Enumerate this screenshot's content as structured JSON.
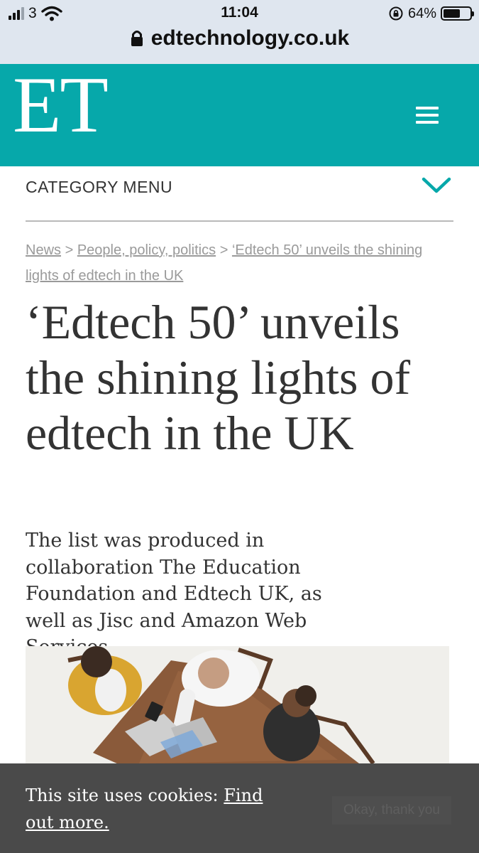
{
  "status_bar": {
    "carrier": "3",
    "time": "11:04",
    "battery_percent_label": "64%",
    "battery_level": 0.64,
    "url": "edtechnology.co.uk"
  },
  "site": {
    "logo": "ET",
    "brand_color": "#06a8aa",
    "menu_icon": "hamburger-menu-icon"
  },
  "category_menu": {
    "label": "CATEGORY MENU",
    "icon": "chevron-down-icon"
  },
  "breadcrumb": [
    {
      "label": "News"
    },
    {
      "label": "People, policy, politics"
    },
    {
      "label": "‘Edtech 50’ unveils the shining lights of edtech in the UK"
    }
  ],
  "breadcrumb_separator": ">",
  "article": {
    "headline": "‘Edtech 50’ unveils the shining lights of edtech in the UK",
    "standfirst": "The list was produced in collaboration The Education Foundation and Edtech UK, as well as Jisc and Amazon Web Services"
  },
  "cookie_banner": {
    "text": "This site uses cookies: ",
    "link": "Find out more.",
    "button": "Okay, thank you"
  }
}
